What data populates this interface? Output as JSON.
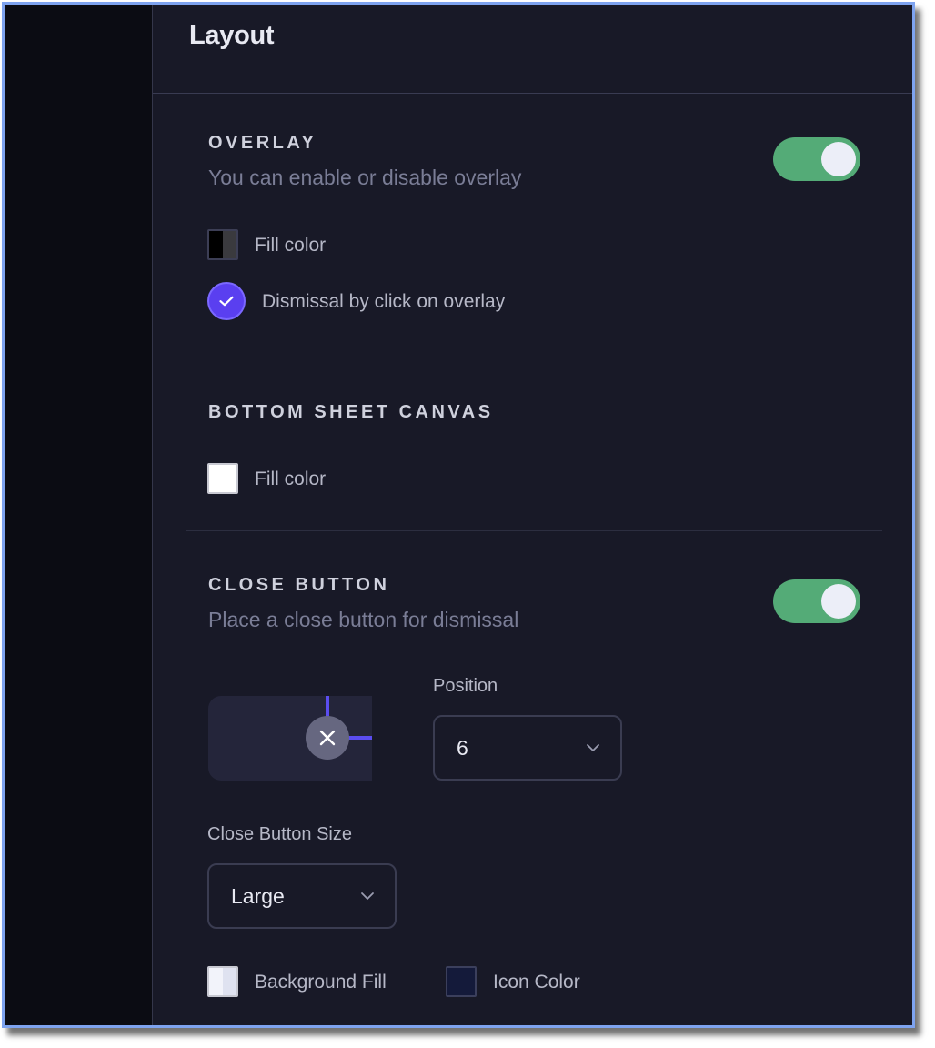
{
  "header": {
    "title": "Layout"
  },
  "overlay": {
    "title": "OVERLAY",
    "description": "You can enable or disable overlay",
    "toggle_on": true,
    "fill_label": "Fill color",
    "dismissal_label": "Dismissal by click on overlay",
    "dismissal_checked": true
  },
  "canvas": {
    "title": "BOTTOM SHEET CANVAS",
    "fill_label": "Fill color"
  },
  "close_button": {
    "title": "CLOSE BUTTON",
    "description": "Place a close button for dismissal",
    "toggle_on": true,
    "position_label": "Position",
    "position_value": "6",
    "size_label": "Close Button Size",
    "size_value": "Large",
    "background_fill_label": "Background Fill",
    "icon_color_label": "Icon Color"
  },
  "colors": {
    "background": "#181927",
    "sidebar": "#0b0c13",
    "toggle": "#54ab77",
    "accent": "#5a3ff0",
    "window_border": "#7ea3ef"
  },
  "icons": {
    "check": "check-icon",
    "close": "close-icon",
    "chevron": "chevron-down-icon"
  }
}
